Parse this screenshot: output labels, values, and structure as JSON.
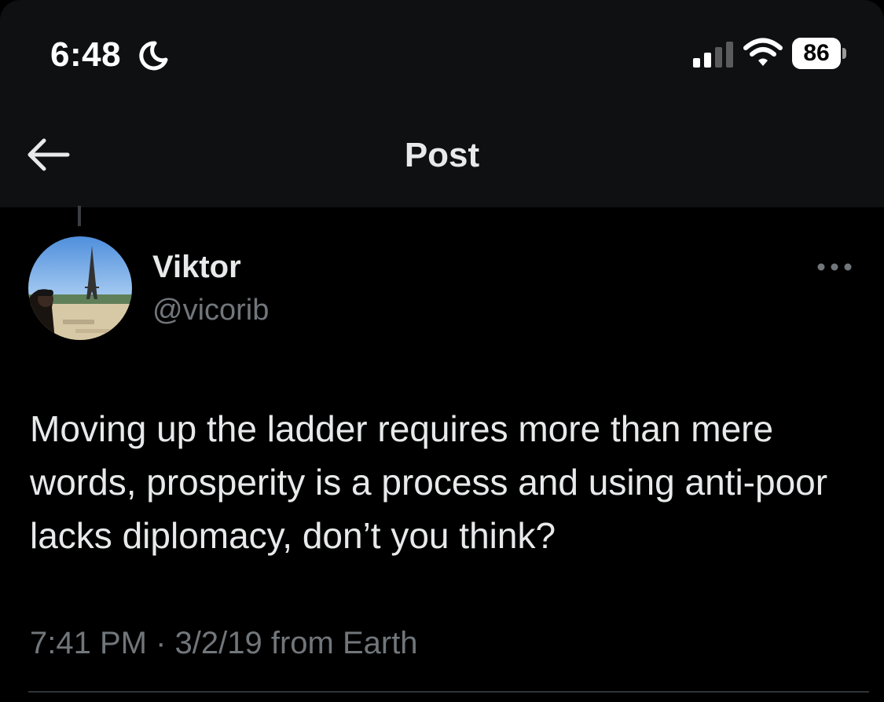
{
  "status_bar": {
    "time": "6:48",
    "battery": "86",
    "icons": [
      "moon-icon",
      "cellular-signal-icon",
      "wifi-icon",
      "battery-icon"
    ]
  },
  "header": {
    "title": "Post",
    "back_icon": "arrow-left-icon"
  },
  "post": {
    "author": {
      "name": "Viktor",
      "handle": "@vicorib"
    },
    "text": "Moving up the ladder requires more than mere words, prosperity is a process and using anti-poor lacks diplomacy, don’t you think?",
    "meta": "7:41 PM · 3/2/19 from Earth",
    "more_icon": "more-dots-icon"
  },
  "colors": {
    "background": "#000000",
    "header_background": "#0f1012",
    "primary_text": "#e7e9ea",
    "secondary_text": "#71767b"
  }
}
